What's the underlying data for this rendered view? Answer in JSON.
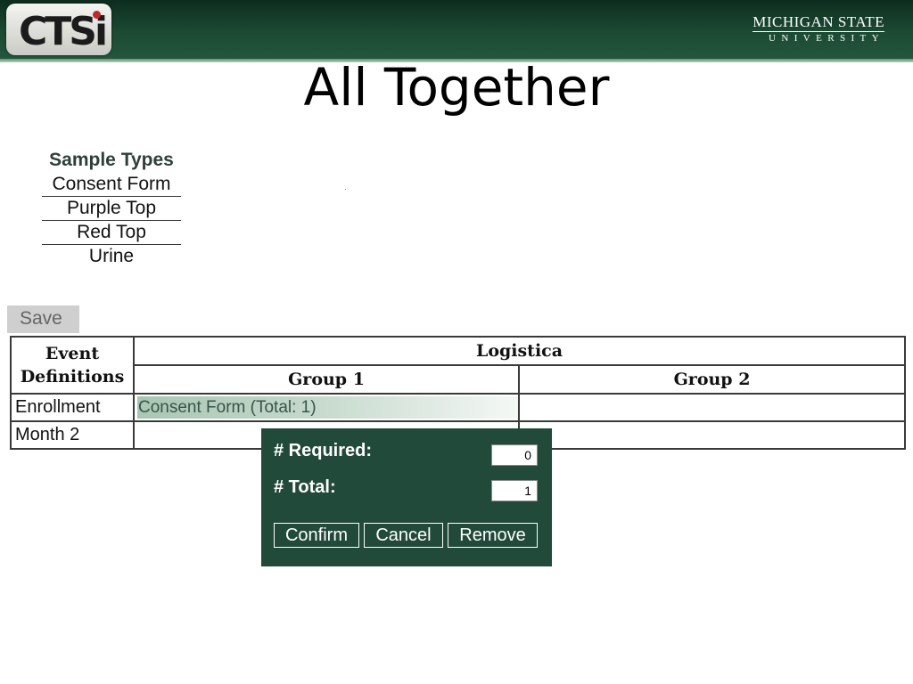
{
  "header": {
    "logo_text": "CTSi",
    "university_name": "MICHIGAN STATE",
    "university_sub": "UNIVERSITY"
  },
  "page_title": "All Together",
  "sample_types": {
    "header": "Sample Types",
    "items": [
      "Consent Form",
      "Purple Top",
      "Red Top",
      "Urine"
    ]
  },
  "toolbar": {
    "save_label": "Save"
  },
  "grid": {
    "corner_header": "Event Definitions",
    "logistica_header": "Logistica",
    "group_headers": [
      "Group 1",
      "Group 2"
    ],
    "rows": [
      {
        "label": "Enrollment",
        "group1": "Consent Form (Total: 1)",
        "group2": ""
      },
      {
        "label": "Month 2",
        "group1": "",
        "group2": ""
      }
    ]
  },
  "popup": {
    "required_label": "# Required:",
    "required_value": "0",
    "total_label": "# Total:",
    "total_value": "1",
    "confirm_label": "Confirm",
    "cancel_label": "Cancel",
    "remove_label": "Remove"
  },
  "colors": {
    "banner": "#1c4a33",
    "popup_bg": "#224a3a",
    "logo_accent": "#c0282d",
    "chip_green": "#a9c6b4"
  }
}
